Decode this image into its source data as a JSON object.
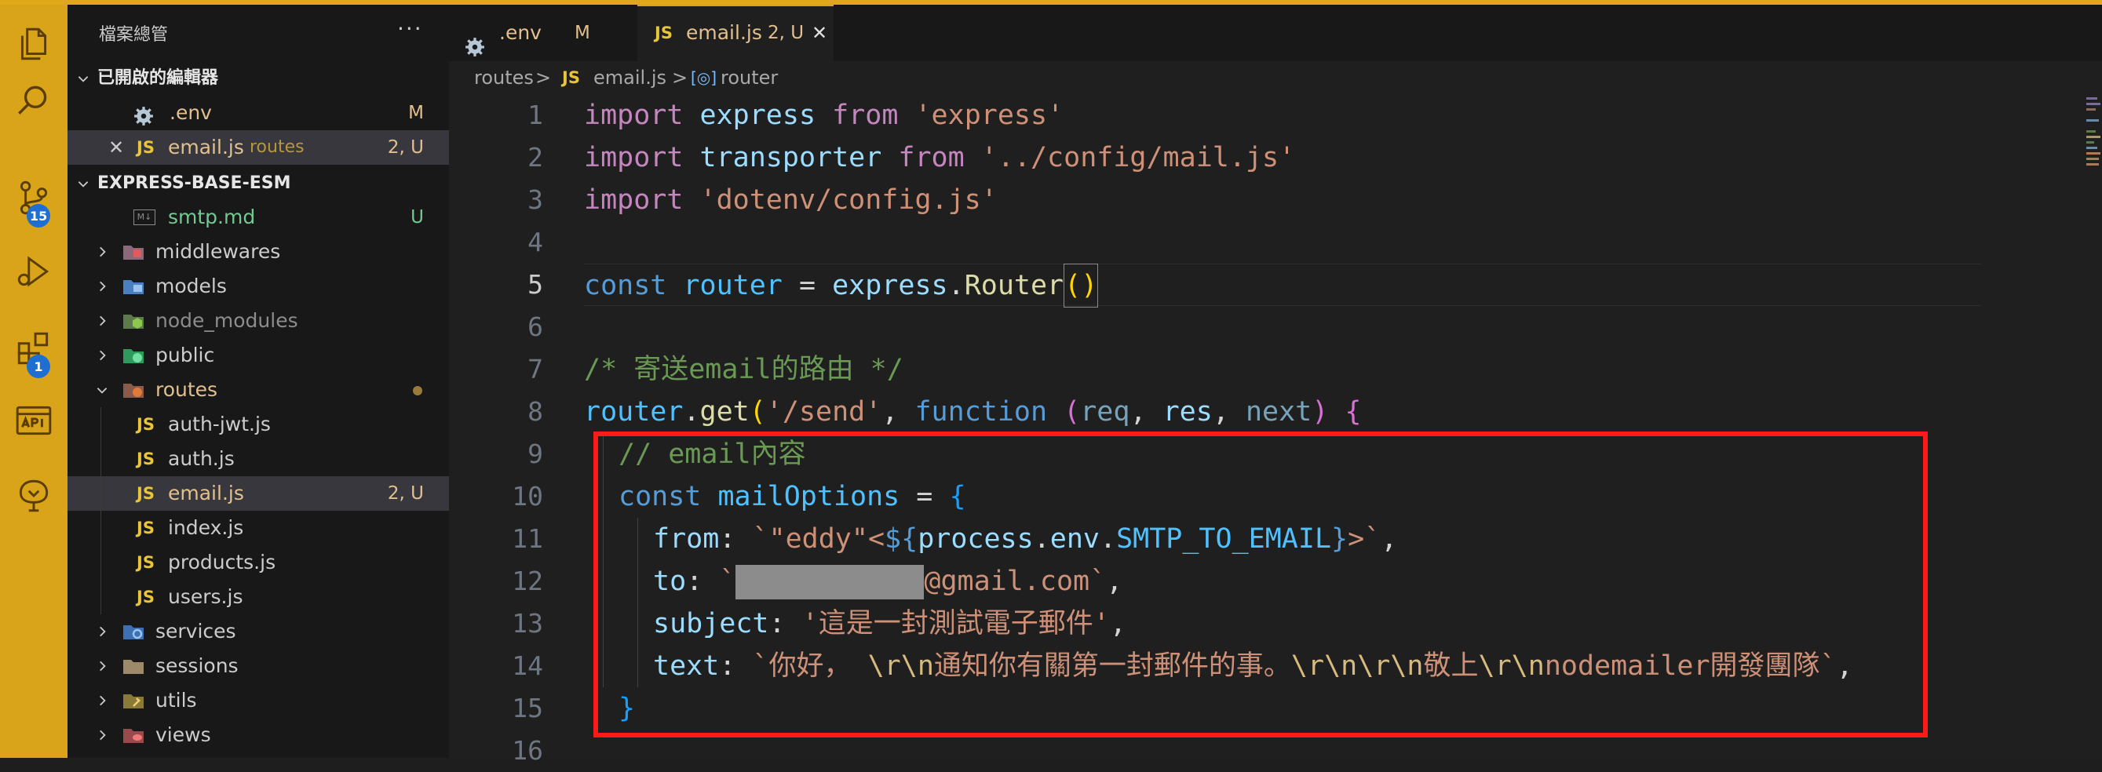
{
  "activity_bar": {
    "scm_badge": "15",
    "extensions_badge": "1"
  },
  "explorer": {
    "title": "檔案總管",
    "more": "···",
    "open_editors": {
      "label": "已開啟的編輯器",
      "items": [
        {
          "name": ".env",
          "status": "M"
        },
        {
          "name": "email.js",
          "folder": "routes",
          "status": "2, U"
        }
      ]
    },
    "project": {
      "label": "EXPRESS-BASE-ESM",
      "items": [
        {
          "name": "smtp.md",
          "status": "U"
        },
        {
          "name": "middlewares"
        },
        {
          "name": "models"
        },
        {
          "name": "node_modules"
        },
        {
          "name": "public"
        },
        {
          "name": "routes"
        },
        {
          "name": "auth-jwt.js"
        },
        {
          "name": "auth.js"
        },
        {
          "name": "email.js",
          "status": "2, U"
        },
        {
          "name": "index.js"
        },
        {
          "name": "products.js"
        },
        {
          "name": "users.js"
        },
        {
          "name": "services"
        },
        {
          "name": "sessions"
        },
        {
          "name": "utils"
        },
        {
          "name": "views"
        }
      ]
    },
    "js_icon": "JS"
  },
  "tabs": [
    {
      "label": ".env",
      "status": "M"
    },
    {
      "label": "email.js",
      "status": "2, U"
    }
  ],
  "breadcrumb": {
    "folder": "routes",
    "sep": ">",
    "file": "email.js",
    "symbol": "router"
  },
  "editor": {
    "line_numbers": [
      "1",
      "2",
      "3",
      "4",
      "5",
      "6",
      "7",
      "8",
      "9",
      "10",
      "11",
      "12",
      "13",
      "14",
      "15",
      "16"
    ],
    "current_line": "5",
    "code": {
      "l1": {
        "kw": "import",
        "name": "express",
        "from": "from",
        "str": "'express'"
      },
      "l2": {
        "kw": "import",
        "name": "transporter",
        "from": "from",
        "str": "'../config/mail.js'"
      },
      "l3": {
        "kw": "import",
        "str": "'dotenv/config.js'"
      },
      "l5": {
        "kw": "const",
        "name": "router",
        "eq": " = ",
        "obj": "express",
        "dot": ".",
        "fn": "Router",
        "open": "(",
        "close": ")"
      },
      "l7": {
        "comment": "/* 寄送email的路由 */"
      },
      "l8": {
        "obj": "router",
        "fn": "get",
        "str": "'/send'",
        "kw": "function",
        "p1": "req",
        "p2": "res",
        "p3": "next"
      },
      "l9": {
        "comment": "// email內容"
      },
      "l10": {
        "kw": "const",
        "name": "mailOptions",
        "eq": " = "
      },
      "l11": {
        "prop": "from",
        "tpl_start": "`\"eddy\"<",
        "expr_open": "${",
        "obj": "process",
        "prop2": "env",
        "const": "SMTP_TO_EMAIL",
        "expr_close": "}",
        "tpl_end": ">`"
      },
      "l12": {
        "prop": "to",
        "tpl_start": "`",
        "tpl_end": "@gmail.com`"
      },
      "l13": {
        "prop": "subject",
        "str": "'這是一封測試電子郵件'"
      },
      "l14": {
        "prop": "text",
        "s1": "`你好， ",
        "e1": "\\r\\n",
        "s2": "通知你有關第一封郵件的事。",
        "e2": "\\r\\n\\r\\n",
        "s3": "敬上",
        "e3": "\\r\\n",
        "s4": "nodemailer開發團隊`"
      },
      "l15": {
        "close": "}"
      }
    }
  },
  "colors": {
    "accent": "#d9a41a",
    "highlight_box": "#ff1a1a",
    "modified": "#e2c08d",
    "untracked": "#73c991"
  }
}
